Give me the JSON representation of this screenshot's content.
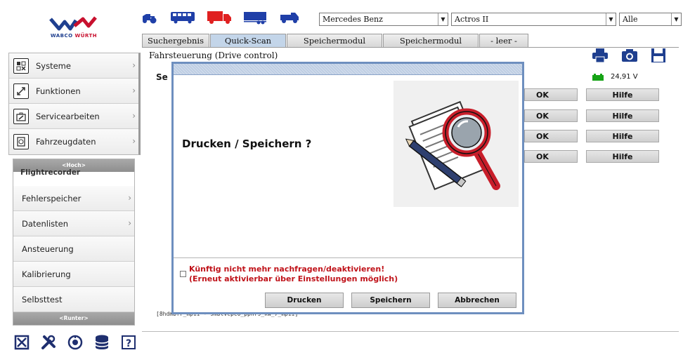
{
  "logo": {
    "brand_a": "WABCO",
    "brand_sep": " ",
    "brand_b": "WÜRTH"
  },
  "menu": {
    "items": [
      {
        "label": "Systeme",
        "icon": "systems-icon"
      },
      {
        "label": "Funktionen",
        "icon": "functions-icon"
      },
      {
        "label": "Servicearbeiten",
        "icon": "toolbox-icon"
      },
      {
        "label": "Fahrzeugdaten",
        "icon": "vehicle-data-icon"
      }
    ]
  },
  "submenu": {
    "up_label": "<Hoch>",
    "peek_label": "Flightrecorder",
    "items": [
      {
        "label": "Fehlerspeicher",
        "arrow": "›"
      },
      {
        "label": "Datenlisten",
        "arrow": "›"
      },
      {
        "label": "Ansteuerung",
        "arrow": ""
      },
      {
        "label": "Kalibrierung",
        "arrow": ""
      },
      {
        "label": "Selbsttest",
        "arrow": ""
      }
    ],
    "down_label": "<Runter>"
  },
  "selects": {
    "make": "Mercedes Benz",
    "model": "Actros II",
    "filter": "Alle"
  },
  "tabs": [
    {
      "label": "Suchergebnis",
      "active": false
    },
    {
      "label": "Quick-Scan",
      "active": true
    },
    {
      "label": "Speichermodul",
      "active": false
    },
    {
      "label": "Speichermodul",
      "active": false
    },
    {
      "label": "- leer -",
      "active": false
    }
  ],
  "content": {
    "title": "Fahrsteuerung (Drive control)",
    "peek": "Se",
    "voltage": "24,91 V",
    "rows": [
      {
        "status": "OK",
        "help": "Hilfe"
      },
      {
        "status": "OK",
        "help": "Hilfe"
      },
      {
        "status": "OK",
        "help": "Hilfe"
      },
      {
        "status": "OK",
        "help": "Hilfe"
      }
    ],
    "footer_path": "[8hdmbfr_mpii - 9mblvcpc0_ppnr9_kw_7_mpii]"
  },
  "modal": {
    "question": "Drucken / Speichern ?",
    "checkbox_line1": "Künftig nicht mehr nachfragen/deaktivieren!",
    "checkbox_line2": "(Erneut aktivierbar über Einstellungen möglich)",
    "btn_print": "Drucken",
    "btn_save": "Speichern",
    "btn_cancel": "Abbrechen"
  },
  "colors": {
    "accent": "#6e8fbf",
    "warning_text": "#c0131a",
    "active_tab": "#c3d5e9",
    "truck_red": "#e02020",
    "bus_blue": "#1f3fa8"
  }
}
